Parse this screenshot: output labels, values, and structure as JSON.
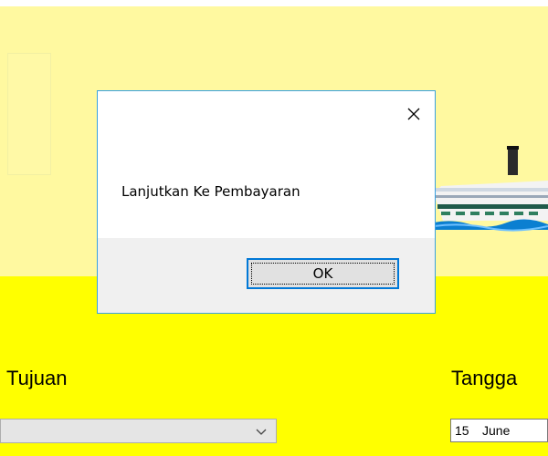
{
  "background": {
    "panel_color": "#fff9a0",
    "form_color": "#ffff00"
  },
  "form": {
    "tujuan_label": "Tujuan",
    "tanggal_label": "Tangga",
    "tujuan_value": "",
    "date_day": "15",
    "date_month": "June"
  },
  "dialog": {
    "message": "Lanjutkan Ke Pembayaran",
    "ok_label": "OK",
    "close_icon": "close-icon",
    "accent": "#0078d7"
  }
}
